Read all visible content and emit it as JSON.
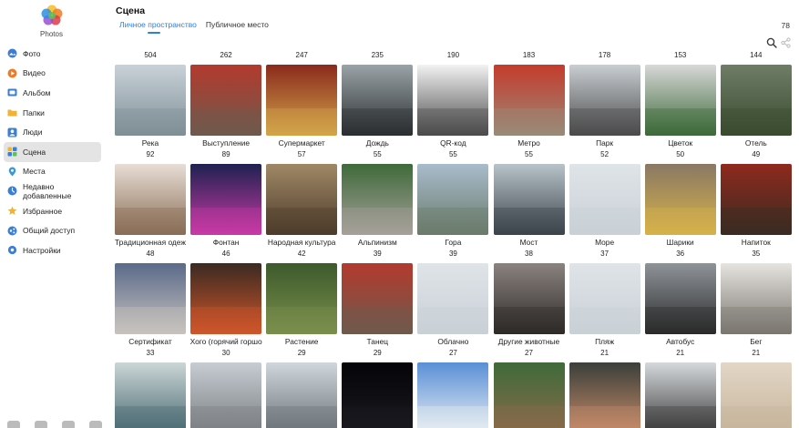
{
  "app": {
    "name": "Photos"
  },
  "sidebar": {
    "items": [
      {
        "label": "Фото",
        "icon": "photos-icon",
        "color": "#3a7fd5"
      },
      {
        "label": "Видео",
        "icon": "video-icon",
        "color": "#f07b22"
      },
      {
        "label": "Альбом",
        "icon": "album-icon",
        "color": "#3a7fd5"
      },
      {
        "label": "Папки",
        "icon": "folder-icon",
        "color": "#f2b233"
      },
      {
        "label": "Люди",
        "icon": "people-icon",
        "color": "#3a7fd5"
      },
      {
        "label": "Сцена",
        "icon": "scene-icon",
        "color": "#3a7fd5"
      },
      {
        "label": "Места",
        "icon": "location-icon",
        "color": "#3a9ad5"
      },
      {
        "label": "Недавно добавленные",
        "icon": "recent-icon",
        "color": "#3a7fd5"
      },
      {
        "label": "Избранное",
        "icon": "star-icon",
        "color": "#f2b233"
      },
      {
        "label": "Общий доступ",
        "icon": "share-icon",
        "color": "#3a7fd5"
      },
      {
        "label": "Настройки",
        "icon": "settings-icon",
        "color": "#3a7fd5"
      }
    ],
    "active_index": 5
  },
  "header": {
    "title": "Сцена",
    "tabs": [
      {
        "label": "Личное пространство",
        "active": true
      },
      {
        "label": "Публичное место",
        "active": false
      }
    ],
    "count": "78"
  },
  "accent": "#2f7fe0",
  "grid": [
    [
      {
        "count": "504",
        "label": "Река",
        "bg": [
          "#c9d2d8",
          "#7f8f96"
        ]
      },
      {
        "count": "262",
        "label": "Выступление",
        "bg": [
          "#b33a2e",
          "#6f5a4c"
        ]
      },
      {
        "count": "247",
        "label": "Супермаркет",
        "bg": [
          "#8a2a1c",
          "#d3a54a"
        ]
      },
      {
        "count": "235",
        "label": "Дождь",
        "bg": [
          "#9aa3a8",
          "#2b2e30"
        ]
      },
      {
        "count": "190",
        "label": "QR-код",
        "bg": [
          "#f2f2f2",
          "#4a4a4a"
        ]
      },
      {
        "count": "183",
        "label": "Метро",
        "bg": [
          "#c43b2c",
          "#9a8a78"
        ]
      },
      {
        "count": "178",
        "label": "Парк",
        "bg": [
          "#c9ced2",
          "#4b4b4b"
        ]
      },
      {
        "count": "153",
        "label": "Цветок",
        "bg": [
          "#d8d8d8",
          "#3d6a3a"
        ]
      },
      {
        "count": "144",
        "label": "Отель",
        "bg": [
          "#6f7d67",
          "#3a4b2f"
        ]
      }
    ],
    [
      {
        "count": "92",
        "label": "Традиционная одеж",
        "bg": [
          "#e8ded6",
          "#8a6d56"
        ]
      },
      {
        "count": "89",
        "label": "Фонтан",
        "bg": [
          "#1e2250",
          "#c93aa6"
        ]
      },
      {
        "count": "57",
        "label": "Народная культура",
        "bg": [
          "#a08866",
          "#4e3c2c"
        ]
      },
      {
        "count": "55",
        "label": "Альпинизм",
        "bg": [
          "#3f6a3a",
          "#a6a09a"
        ]
      },
      {
        "count": "55",
        "label": "Гора",
        "bg": [
          "#a9bccc",
          "#6a7b6b"
        ]
      },
      {
        "count": "55",
        "label": "Мост",
        "bg": [
          "#b8c3ca",
          "#3b444a"
        ]
      },
      {
        "count": "52",
        "label": "Море",
        "bg": [
          "#dfe4e8",
          "#c9d0d6"
        ]
      },
      {
        "count": "50",
        "label": "Шарики",
        "bg": [
          "#8a7864",
          "#d6b24a"
        ]
      },
      {
        "count": "49",
        "label": "Напиток",
        "bg": [
          "#8f2a1e",
          "#3a2b22"
        ]
      }
    ],
    [
      {
        "count": "48",
        "label": "Сертификат",
        "bg": [
          "#5a6a8a",
          "#c8c3be"
        ]
      },
      {
        "count": "46",
        "label": "Хого (горячий горшо",
        "bg": [
          "#3a2a22",
          "#d0562a"
        ]
      },
      {
        "count": "42",
        "label": "Растение",
        "bg": [
          "#3d5a2c",
          "#7b8f4c"
        ]
      },
      {
        "count": "39",
        "label": "Танец",
        "bg": [
          "#b33a2e",
          "#6f5a4c"
        ]
      },
      {
        "count": "39",
        "label": "Облачно",
        "bg": [
          "#dfe4e8",
          "#c9d0d6"
        ]
      },
      {
        "count": "38",
        "label": "Другие животные",
        "bg": [
          "#8a8380",
          "#2e2a28"
        ]
      },
      {
        "count": "37",
        "label": "Пляж",
        "bg": [
          "#dfe4e8",
          "#c9d0d6"
        ]
      },
      {
        "count": "36",
        "label": "Автобус",
        "bg": [
          "#8f949a",
          "#2b2b2b"
        ]
      },
      {
        "count": "35",
        "label": "Бег",
        "bg": [
          "#e6e4df",
          "#7a7670"
        ]
      }
    ],
    [
      {
        "count": "33",
        "label": "",
        "bg": [
          "#cbd6d6",
          "#4a6a72"
        ]
      },
      {
        "count": "30",
        "label": "",
        "bg": [
          "#c6cdd3",
          "#7b7f82"
        ]
      },
      {
        "count": "29",
        "label": "",
        "bg": [
          "#cfd6dc",
          "#6c7479"
        ]
      },
      {
        "count": "29",
        "label": "",
        "bg": [
          "#050508",
          "#1a1a20"
        ]
      },
      {
        "count": "27",
        "label": "",
        "bg": [
          "#5a8fd6",
          "#e8eef2"
        ]
      },
      {
        "count": "27",
        "label": "",
        "bg": [
          "#3f6a3a",
          "#8a6a4a"
        ]
      },
      {
        "count": "21",
        "label": "",
        "bg": [
          "#3a3f3a",
          "#c78b6a"
        ]
      },
      {
        "count": "21",
        "label": "",
        "bg": [
          "#d6d9dc",
          "#3b3b3b"
        ]
      },
      {
        "count": "21",
        "label": "",
        "bg": [
          "#e2d6c6",
          "#c7b59c"
        ]
      }
    ]
  ]
}
